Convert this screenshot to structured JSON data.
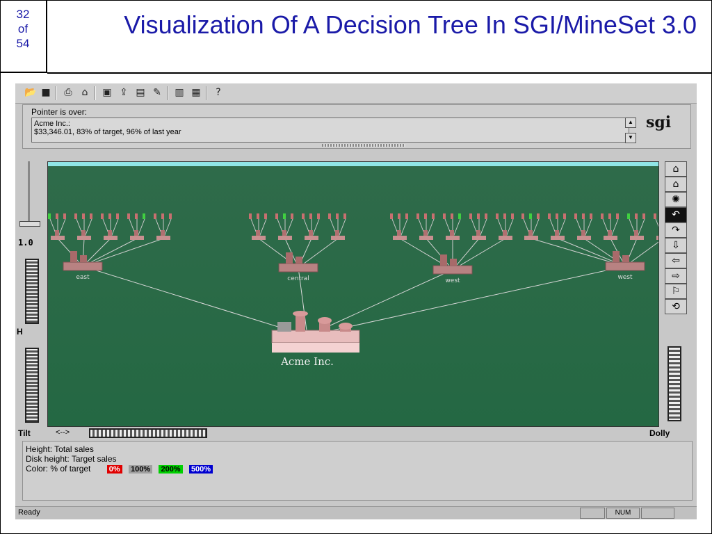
{
  "slide": {
    "page_number": "32",
    "page_of": "of",
    "page_total": "54",
    "title": "Visualization Of A Decision Tree In SGI/MineSet 3.0"
  },
  "toolbar": {
    "icons": [
      "open-folder-icon",
      "save-icon",
      "print-icon",
      "print-setup-icon",
      "load-icon",
      "export-icon",
      "view-icon",
      "edit-icon",
      "data-icon",
      "window-icon",
      "help-icon"
    ]
  },
  "info": {
    "pointer_label": "Pointer is over:",
    "line1": "Acme Inc.:",
    "line2": "$33,346.01, 83% of target, 96% of last year",
    "logo": "sgi"
  },
  "tree": {
    "root_label": "Acme Inc.",
    "child_labels": [
      "east",
      "central",
      "west",
      "west"
    ]
  },
  "controls": {
    "zoom_value": "1.0",
    "height_label": "H",
    "tilt_label": "Tilt",
    "arrows_label": "<-->",
    "dolly_label": "Dolly"
  },
  "legend": {
    "height_text": "Height: Total sales",
    "disk_text": "Disk height: Target sales",
    "color_text": "Color: % of target",
    "chips": [
      {
        "label": "0%",
        "bg": "#e00000",
        "fg": "#ffffff"
      },
      {
        "label": "100%",
        "bg": "#a0a0a0",
        "fg": "#000000"
      },
      {
        "label": "200%",
        "bg": "#00d000",
        "fg": "#000000"
      },
      {
        "label": "500%",
        "bg": "#0000d0",
        "fg": "#ffffff"
      }
    ]
  },
  "status": {
    "text": "Ready",
    "num": "NUM"
  },
  "colors": {
    "title": "#1a1aa8",
    "ground": "#246843",
    "sky": "#8fe6e6"
  }
}
